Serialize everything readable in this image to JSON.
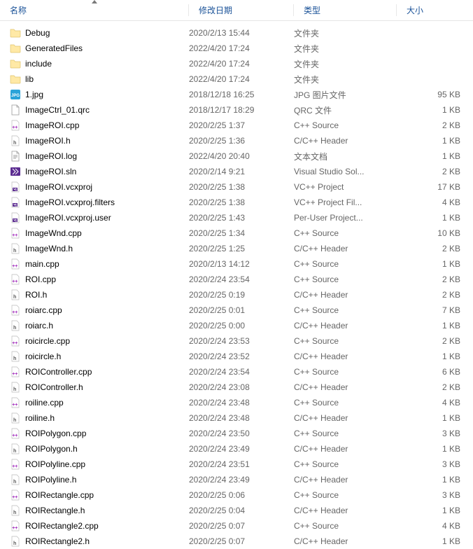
{
  "header": {
    "name": "名称",
    "date": "修改日期",
    "type": "类型",
    "size": "大小"
  },
  "files": [
    {
      "icon": "folder",
      "name": "Debug",
      "date": "2020/2/13 15:44",
      "type": "文件夹",
      "size": ""
    },
    {
      "icon": "folder",
      "name": "GeneratedFiles",
      "date": "2022/4/20 17:24",
      "type": "文件夹",
      "size": ""
    },
    {
      "icon": "folder",
      "name": "include",
      "date": "2022/4/20 17:24",
      "type": "文件夹",
      "size": ""
    },
    {
      "icon": "folder",
      "name": "lib",
      "date": "2022/4/20 17:24",
      "type": "文件夹",
      "size": ""
    },
    {
      "icon": "jpg",
      "name": "1.jpg",
      "date": "2018/12/18 16:25",
      "type": "JPG 图片文件",
      "size": "95 KB"
    },
    {
      "icon": "file",
      "name": "ImageCtrl_01.qrc",
      "date": "2018/12/17 18:29",
      "type": "QRC 文件",
      "size": "1 KB"
    },
    {
      "icon": "cpp",
      "name": "ImageROI.cpp",
      "date": "2020/2/25 1:37",
      "type": "C++ Source",
      "size": "2 KB"
    },
    {
      "icon": "h",
      "name": "ImageROI.h",
      "date": "2020/2/25 1:36",
      "type": "C/C++ Header",
      "size": "1 KB"
    },
    {
      "icon": "txt",
      "name": "ImageROI.log",
      "date": "2022/4/20 20:40",
      "type": "文本文档",
      "size": "1 KB"
    },
    {
      "icon": "sln",
      "name": "ImageROI.sln",
      "date": "2020/2/14 9:21",
      "type": "Visual Studio Sol...",
      "size": "2 KB"
    },
    {
      "icon": "vcx",
      "name": "ImageROI.vcxproj",
      "date": "2020/2/25 1:38",
      "type": "VC++ Project",
      "size": "17 KB"
    },
    {
      "icon": "vcx",
      "name": "ImageROI.vcxproj.filters",
      "date": "2020/2/25 1:38",
      "type": "VC++ Project Fil...",
      "size": "4 KB"
    },
    {
      "icon": "vcx",
      "name": "ImageROI.vcxproj.user",
      "date": "2020/2/25 1:43",
      "type": "Per-User Project...",
      "size": "1 KB"
    },
    {
      "icon": "cpp",
      "name": "ImageWnd.cpp",
      "date": "2020/2/25 1:34",
      "type": "C++ Source",
      "size": "10 KB"
    },
    {
      "icon": "h",
      "name": "ImageWnd.h",
      "date": "2020/2/25 1:25",
      "type": "C/C++ Header",
      "size": "2 KB"
    },
    {
      "icon": "cpp",
      "name": "main.cpp",
      "date": "2020/2/13 14:12",
      "type": "C++ Source",
      "size": "1 KB"
    },
    {
      "icon": "cpp",
      "name": "ROI.cpp",
      "date": "2020/2/24 23:54",
      "type": "C++ Source",
      "size": "2 KB"
    },
    {
      "icon": "h",
      "name": "ROI.h",
      "date": "2020/2/25 0:19",
      "type": "C/C++ Header",
      "size": "2 KB"
    },
    {
      "icon": "cpp",
      "name": "roiarc.cpp",
      "date": "2020/2/25 0:01",
      "type": "C++ Source",
      "size": "7 KB"
    },
    {
      "icon": "h",
      "name": "roiarc.h",
      "date": "2020/2/25 0:00",
      "type": "C/C++ Header",
      "size": "1 KB"
    },
    {
      "icon": "cpp",
      "name": "roicircle.cpp",
      "date": "2020/2/24 23:53",
      "type": "C++ Source",
      "size": "2 KB"
    },
    {
      "icon": "h",
      "name": "roicircle.h",
      "date": "2020/2/24 23:52",
      "type": "C/C++ Header",
      "size": "1 KB"
    },
    {
      "icon": "cpp",
      "name": "ROIController.cpp",
      "date": "2020/2/24 23:54",
      "type": "C++ Source",
      "size": "6 KB"
    },
    {
      "icon": "h",
      "name": "ROIController.h",
      "date": "2020/2/24 23:08",
      "type": "C/C++ Header",
      "size": "2 KB"
    },
    {
      "icon": "cpp",
      "name": "roiline.cpp",
      "date": "2020/2/24 23:48",
      "type": "C++ Source",
      "size": "4 KB"
    },
    {
      "icon": "h",
      "name": "roiline.h",
      "date": "2020/2/24 23:48",
      "type": "C/C++ Header",
      "size": "1 KB"
    },
    {
      "icon": "cpp",
      "name": "ROIPolygon.cpp",
      "date": "2020/2/24 23:50",
      "type": "C++ Source",
      "size": "3 KB"
    },
    {
      "icon": "h",
      "name": "ROIPolygon.h",
      "date": "2020/2/24 23:49",
      "type": "C/C++ Header",
      "size": "1 KB"
    },
    {
      "icon": "cpp",
      "name": "ROIPolyline.cpp",
      "date": "2020/2/24 23:51",
      "type": "C++ Source",
      "size": "3 KB"
    },
    {
      "icon": "h",
      "name": "ROIPolyline.h",
      "date": "2020/2/24 23:49",
      "type": "C/C++ Header",
      "size": "1 KB"
    },
    {
      "icon": "cpp",
      "name": "ROIRectangle.cpp",
      "date": "2020/2/25 0:06",
      "type": "C++ Source",
      "size": "3 KB"
    },
    {
      "icon": "h",
      "name": "ROIRectangle.h",
      "date": "2020/2/25 0:04",
      "type": "C/C++ Header",
      "size": "1 KB"
    },
    {
      "icon": "cpp",
      "name": "ROIRectangle2.cpp",
      "date": "2020/2/25 0:07",
      "type": "C++ Source",
      "size": "4 KB"
    },
    {
      "icon": "h",
      "name": "ROIRectangle2.h",
      "date": "2020/2/25 0:07",
      "type": "C/C++ Header",
      "size": "1 KB"
    }
  ]
}
